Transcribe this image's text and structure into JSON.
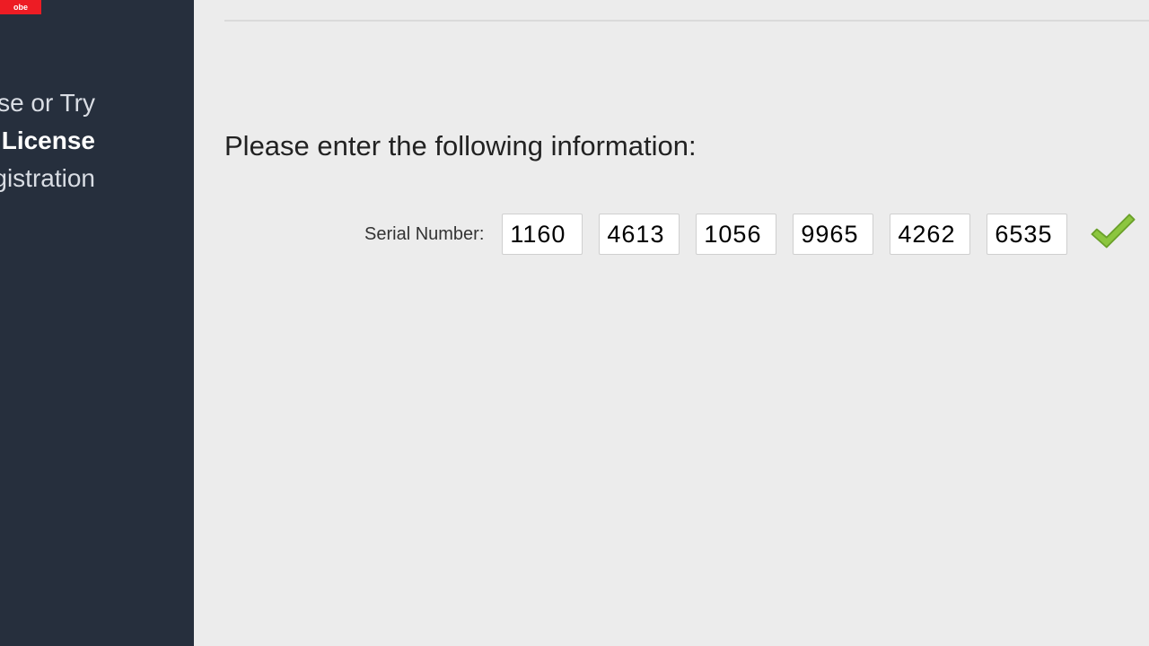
{
  "brand": {
    "logo_text": "obe"
  },
  "sidebar": {
    "items": [
      {
        "label": "License or Try",
        "active": false
      },
      {
        "label": "License",
        "active": true
      },
      {
        "label": "Registration",
        "active": false
      }
    ]
  },
  "main": {
    "instruction": "Please enter the following information:",
    "serial_label": "Serial Number:",
    "serial_parts": [
      "1160",
      "4613",
      "1056",
      "9965",
      "4262",
      "6535"
    ],
    "validation": "valid"
  },
  "colors": {
    "sidebar_bg": "#262f3d",
    "brand_red": "#ed1c24",
    "check_green": "#8cc63f",
    "page_bg": "#ececec"
  }
}
